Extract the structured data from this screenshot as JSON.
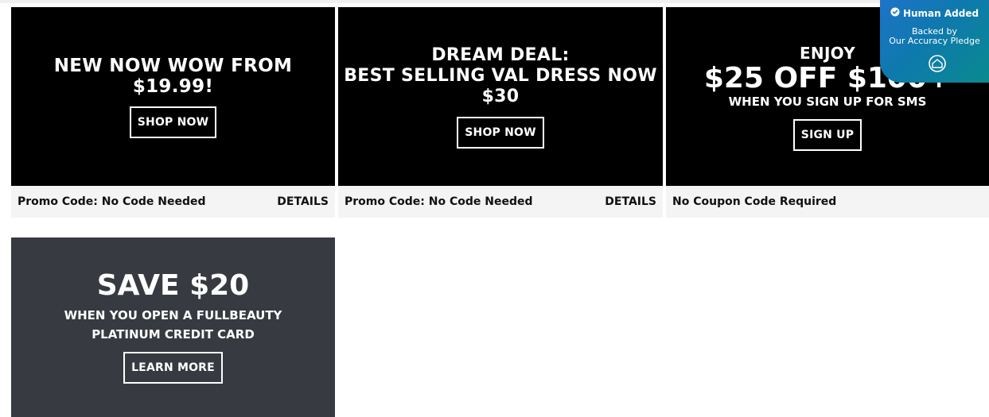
{
  "cards": [
    {
      "headline": "NEW NOW WOW FROM $19.99!",
      "button": "SHOP NOW",
      "footer_left": "Promo Code: No Code Needed",
      "footer_right": "DETAILS"
    },
    {
      "headline_line1": "DREAM DEAL:",
      "headline_line2": "BEST SELLING VAL DRESS NOW",
      "headline_line3": "$30",
      "button": "SHOP NOW",
      "footer_left": "Promo Code: No Code Needed",
      "footer_right": "DETAILS"
    },
    {
      "eyebrow": "ENJOY",
      "headline": "$25 OFF $100+",
      "subline": "WHEN YOU SIGN UP FOR SMS",
      "button": "SIGN UP",
      "footer_left": "No Coupon Code Required"
    }
  ],
  "credit_card": {
    "headline": "SAVE $20",
    "line1": "WHEN YOU OPEN A FULLBEAUTY",
    "line2": "PLATINUM CREDIT CARD",
    "button": "LEARN MORE"
  },
  "badge": {
    "title": "Human Added",
    "line1": "Backed by",
    "line2": "Our Accuracy Pledge",
    "icon": "home-icon"
  },
  "colors": {
    "promo_bg": "#000000",
    "footer_bg": "#f4f4f4",
    "credit_bg": "#373a40",
    "badge_gradient_start": "#1f73c8",
    "badge_gradient_end": "#0a8a8f"
  }
}
